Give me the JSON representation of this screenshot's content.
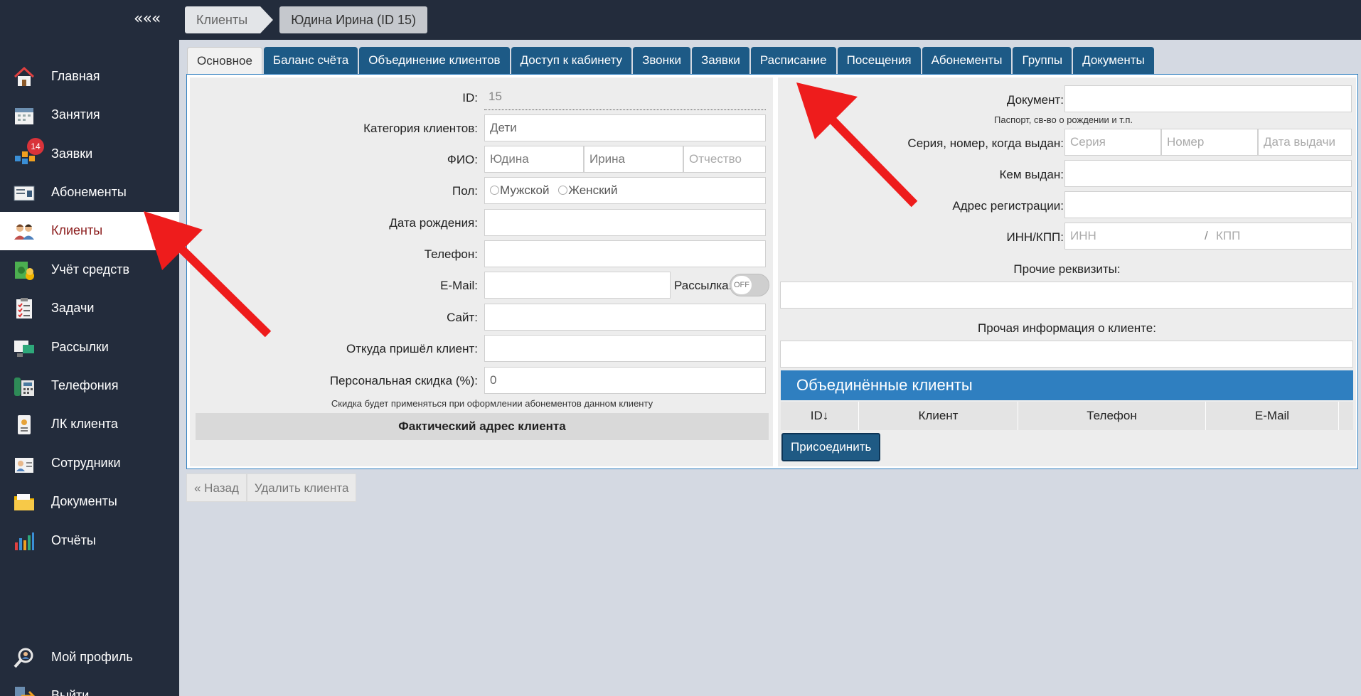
{
  "topbar": {
    "collapse_label": "«««",
    "breadcrumb": [
      "Клиенты",
      "Юдина Ирина (ID 15)"
    ]
  },
  "sidebar": {
    "items": [
      {
        "label": "Главная",
        "icon": "house-icon"
      },
      {
        "label": "Занятия",
        "icon": "calendar-icon"
      },
      {
        "label": "Заявки",
        "icon": "requests-icon",
        "badge": "14"
      },
      {
        "label": "Абонементы",
        "icon": "ticket-icon"
      },
      {
        "label": "Клиенты",
        "icon": "clients-icon",
        "active": true
      },
      {
        "label": "Учёт средств",
        "icon": "money-icon"
      },
      {
        "label": "Задачи",
        "icon": "checklist-icon"
      },
      {
        "label": "Рассылки",
        "icon": "mailing-icon"
      },
      {
        "label": "Телефония",
        "icon": "phone-icon"
      },
      {
        "label": "ЛК клиента",
        "icon": "badge-id-icon"
      },
      {
        "label": "Сотрудники",
        "icon": "staff-icon"
      },
      {
        "label": "Документы",
        "icon": "folder-icon"
      },
      {
        "label": "Отчёты",
        "icon": "bar-chart-icon"
      }
    ],
    "bottom": [
      {
        "label": "Мой профиль",
        "icon": "profile-search-icon"
      },
      {
        "label": "Выйти",
        "icon": "logout-icon"
      }
    ]
  },
  "tabs": [
    "Основное",
    "Баланс счёта",
    "Объединение клиентов",
    "Доступ к кабинету",
    "Звонки",
    "Заявки",
    "Расписание",
    "Посещения",
    "Абонементы",
    "Группы",
    "Документы"
  ],
  "form_left": {
    "id_label": "ID:",
    "id_value": "15",
    "category_label": "Категория клиентов:",
    "category_value": "Дети",
    "fio_label": "ФИО:",
    "last_name": "Юдина",
    "first_name": "Ирина",
    "patronymic_placeholder": "Отчество",
    "gender_label": "Пол:",
    "gender_male": "Мужской",
    "gender_female": "Женский",
    "birthdate_label": "Дата рождения:",
    "phone_label": "Телефон:",
    "email_label": "E-Mail:",
    "mailing_label": "Рассылка:",
    "mailing_toggle": "OFF",
    "site_label": "Сайт:",
    "source_label": "Откуда пришёл клиент:",
    "discount_label": "Персональная скидка (%):",
    "discount_value": "0",
    "discount_hint": "Скидка будет применяться при оформлении абонементов данном клиенту",
    "address_header": "Фактический адрес клиента"
  },
  "form_right": {
    "document_label": "Документ:",
    "document_hint": "Паспорт, св-во о рождении и т.п.",
    "series_label": "Серия, номер, когда выдан:",
    "series_placeholder": "Серия",
    "number_placeholder": "Номер",
    "issue_date_placeholder": "Дата выдачи",
    "issued_by_label": "Кем выдан:",
    "reg_address_label": "Адрес регистрации:",
    "inn_label": "ИНН/КПП:",
    "inn_placeholder": "ИНН",
    "kpp_separator": "/",
    "kpp_placeholder": "КПП",
    "other_requisites_label": "Прочие реквизиты:",
    "other_info_label": "Прочая информация о клиенте:",
    "merged_header": "Объединённые клиенты",
    "table_headers": [
      "ID↓",
      "Клиент",
      "Телефон",
      "E-Mail"
    ],
    "join_button": "Присоединить"
  },
  "actions": {
    "back": "« Назад",
    "delete": "Удалить клиента"
  },
  "colors": {
    "sidebar_bg": "#232c3c",
    "tab_bg": "#1d5a86",
    "accent_blue": "#2f7fc0",
    "arrow_red": "#ee1c1c"
  }
}
